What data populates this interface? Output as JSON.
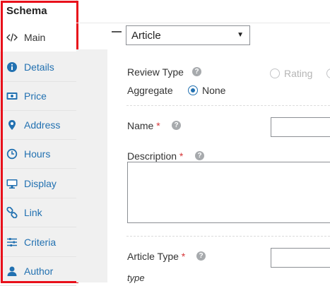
{
  "sidebar": {
    "title": "Schema",
    "items": [
      {
        "label": "Main",
        "icon": "code-icon"
      },
      {
        "label": "Details",
        "icon": "info-icon"
      },
      {
        "label": "Price",
        "icon": "money-icon"
      },
      {
        "label": "Address",
        "icon": "map-marker-icon"
      },
      {
        "label": "Hours",
        "icon": "clock-icon"
      },
      {
        "label": "Display",
        "icon": "monitor-icon"
      },
      {
        "label": "Link",
        "icon": "link-icon"
      },
      {
        "label": "Criteria",
        "icon": "sliders-icon"
      },
      {
        "label": "Author",
        "icon": "user-icon"
      }
    ]
  },
  "schema_type": {
    "selected": "Article"
  },
  "form": {
    "review_type": {
      "label": "Review Type",
      "rating_option": "Rating",
      "aggregate_label": "Aggregate",
      "none_option": "None",
      "selected": "None"
    },
    "name": {
      "label": "Name",
      "required_mark": "*"
    },
    "description": {
      "label": "Description",
      "required_mark": "*"
    },
    "article_type": {
      "label": "Article Type",
      "required_mark": "*",
      "hint": "type"
    }
  },
  "help_glyph": "?",
  "colors": {
    "accent": "#2271b1",
    "highlight_frame": "#e8101a",
    "required": "#d63638"
  }
}
